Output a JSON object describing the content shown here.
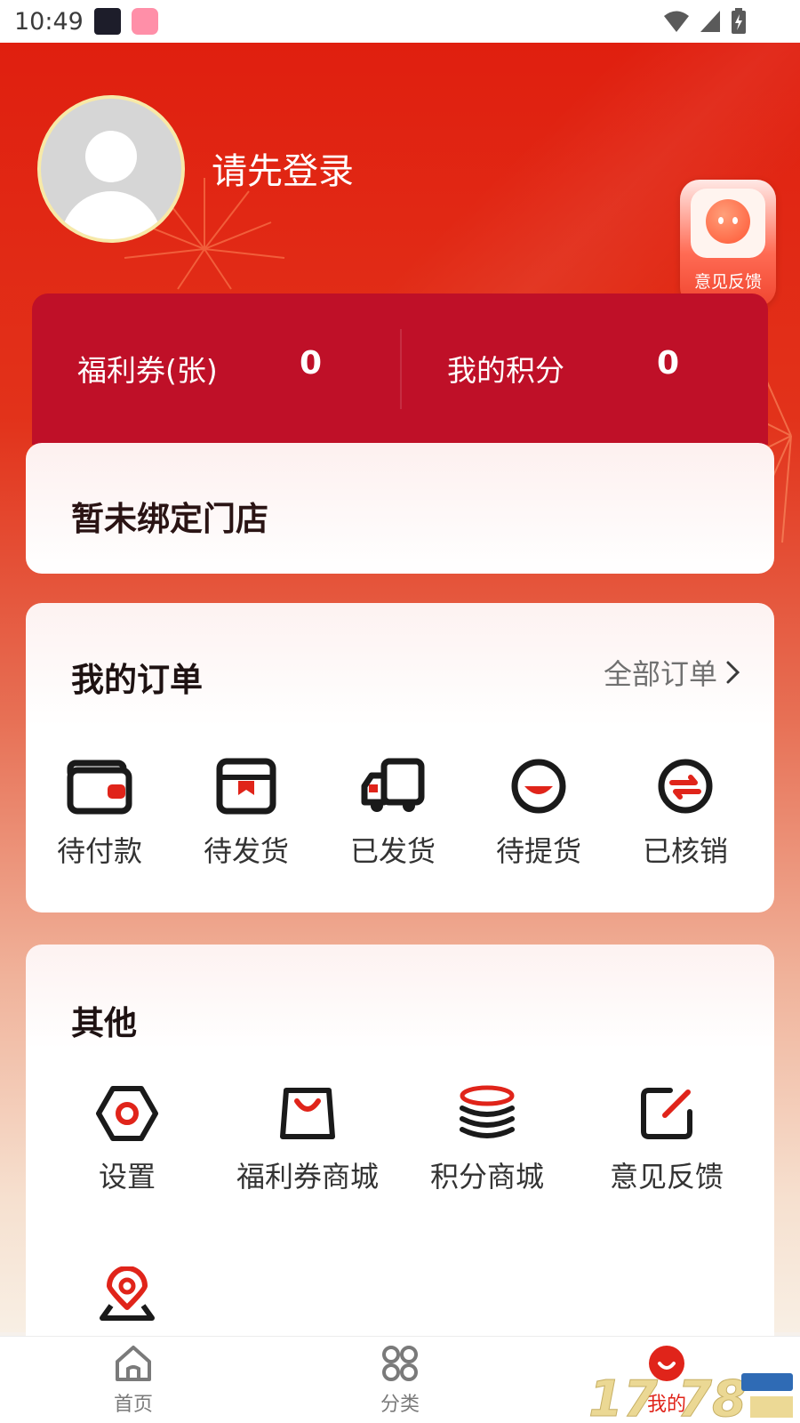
{
  "status_bar": {
    "time": "10:49"
  },
  "profile": {
    "login_prompt": "请先登录"
  },
  "feedback_float": {
    "label": "意见反馈"
  },
  "stats": {
    "coupons_label": "福利券(张)",
    "coupons_value": "0",
    "points_label": "我的积分",
    "points_value": "0"
  },
  "store": {
    "text": "暂未绑定门店"
  },
  "orders": {
    "title": "我的订单",
    "all_label": "全部订单",
    "items": [
      {
        "label": "待付款",
        "icon": "wallet-icon"
      },
      {
        "label": "待发货",
        "icon": "package-icon"
      },
      {
        "label": "已发货",
        "icon": "truck-icon"
      },
      {
        "label": "待提货",
        "icon": "pickup-icon"
      },
      {
        "label": "已核销",
        "icon": "verified-icon"
      }
    ]
  },
  "other": {
    "title": "其他",
    "items": [
      {
        "label": "设置",
        "icon": "settings-icon"
      },
      {
        "label": "福利券商城",
        "icon": "shopping-bag-icon"
      },
      {
        "label": "积分商城",
        "icon": "coins-icon"
      },
      {
        "label": "意见反馈",
        "icon": "edit-icon"
      },
      {
        "label": "",
        "icon": "location-icon"
      }
    ]
  },
  "tabbar": {
    "items": [
      {
        "label": "首页",
        "icon": "home-icon"
      },
      {
        "label": "分类",
        "icon": "category-icon"
      },
      {
        "label": "我的",
        "icon": "profile-icon"
      }
    ],
    "active_index": 2
  },
  "colors": {
    "brand_red": "#e0241a",
    "stats_bg": "#bf1028",
    "icon_dark": "#1a1a1a"
  }
}
